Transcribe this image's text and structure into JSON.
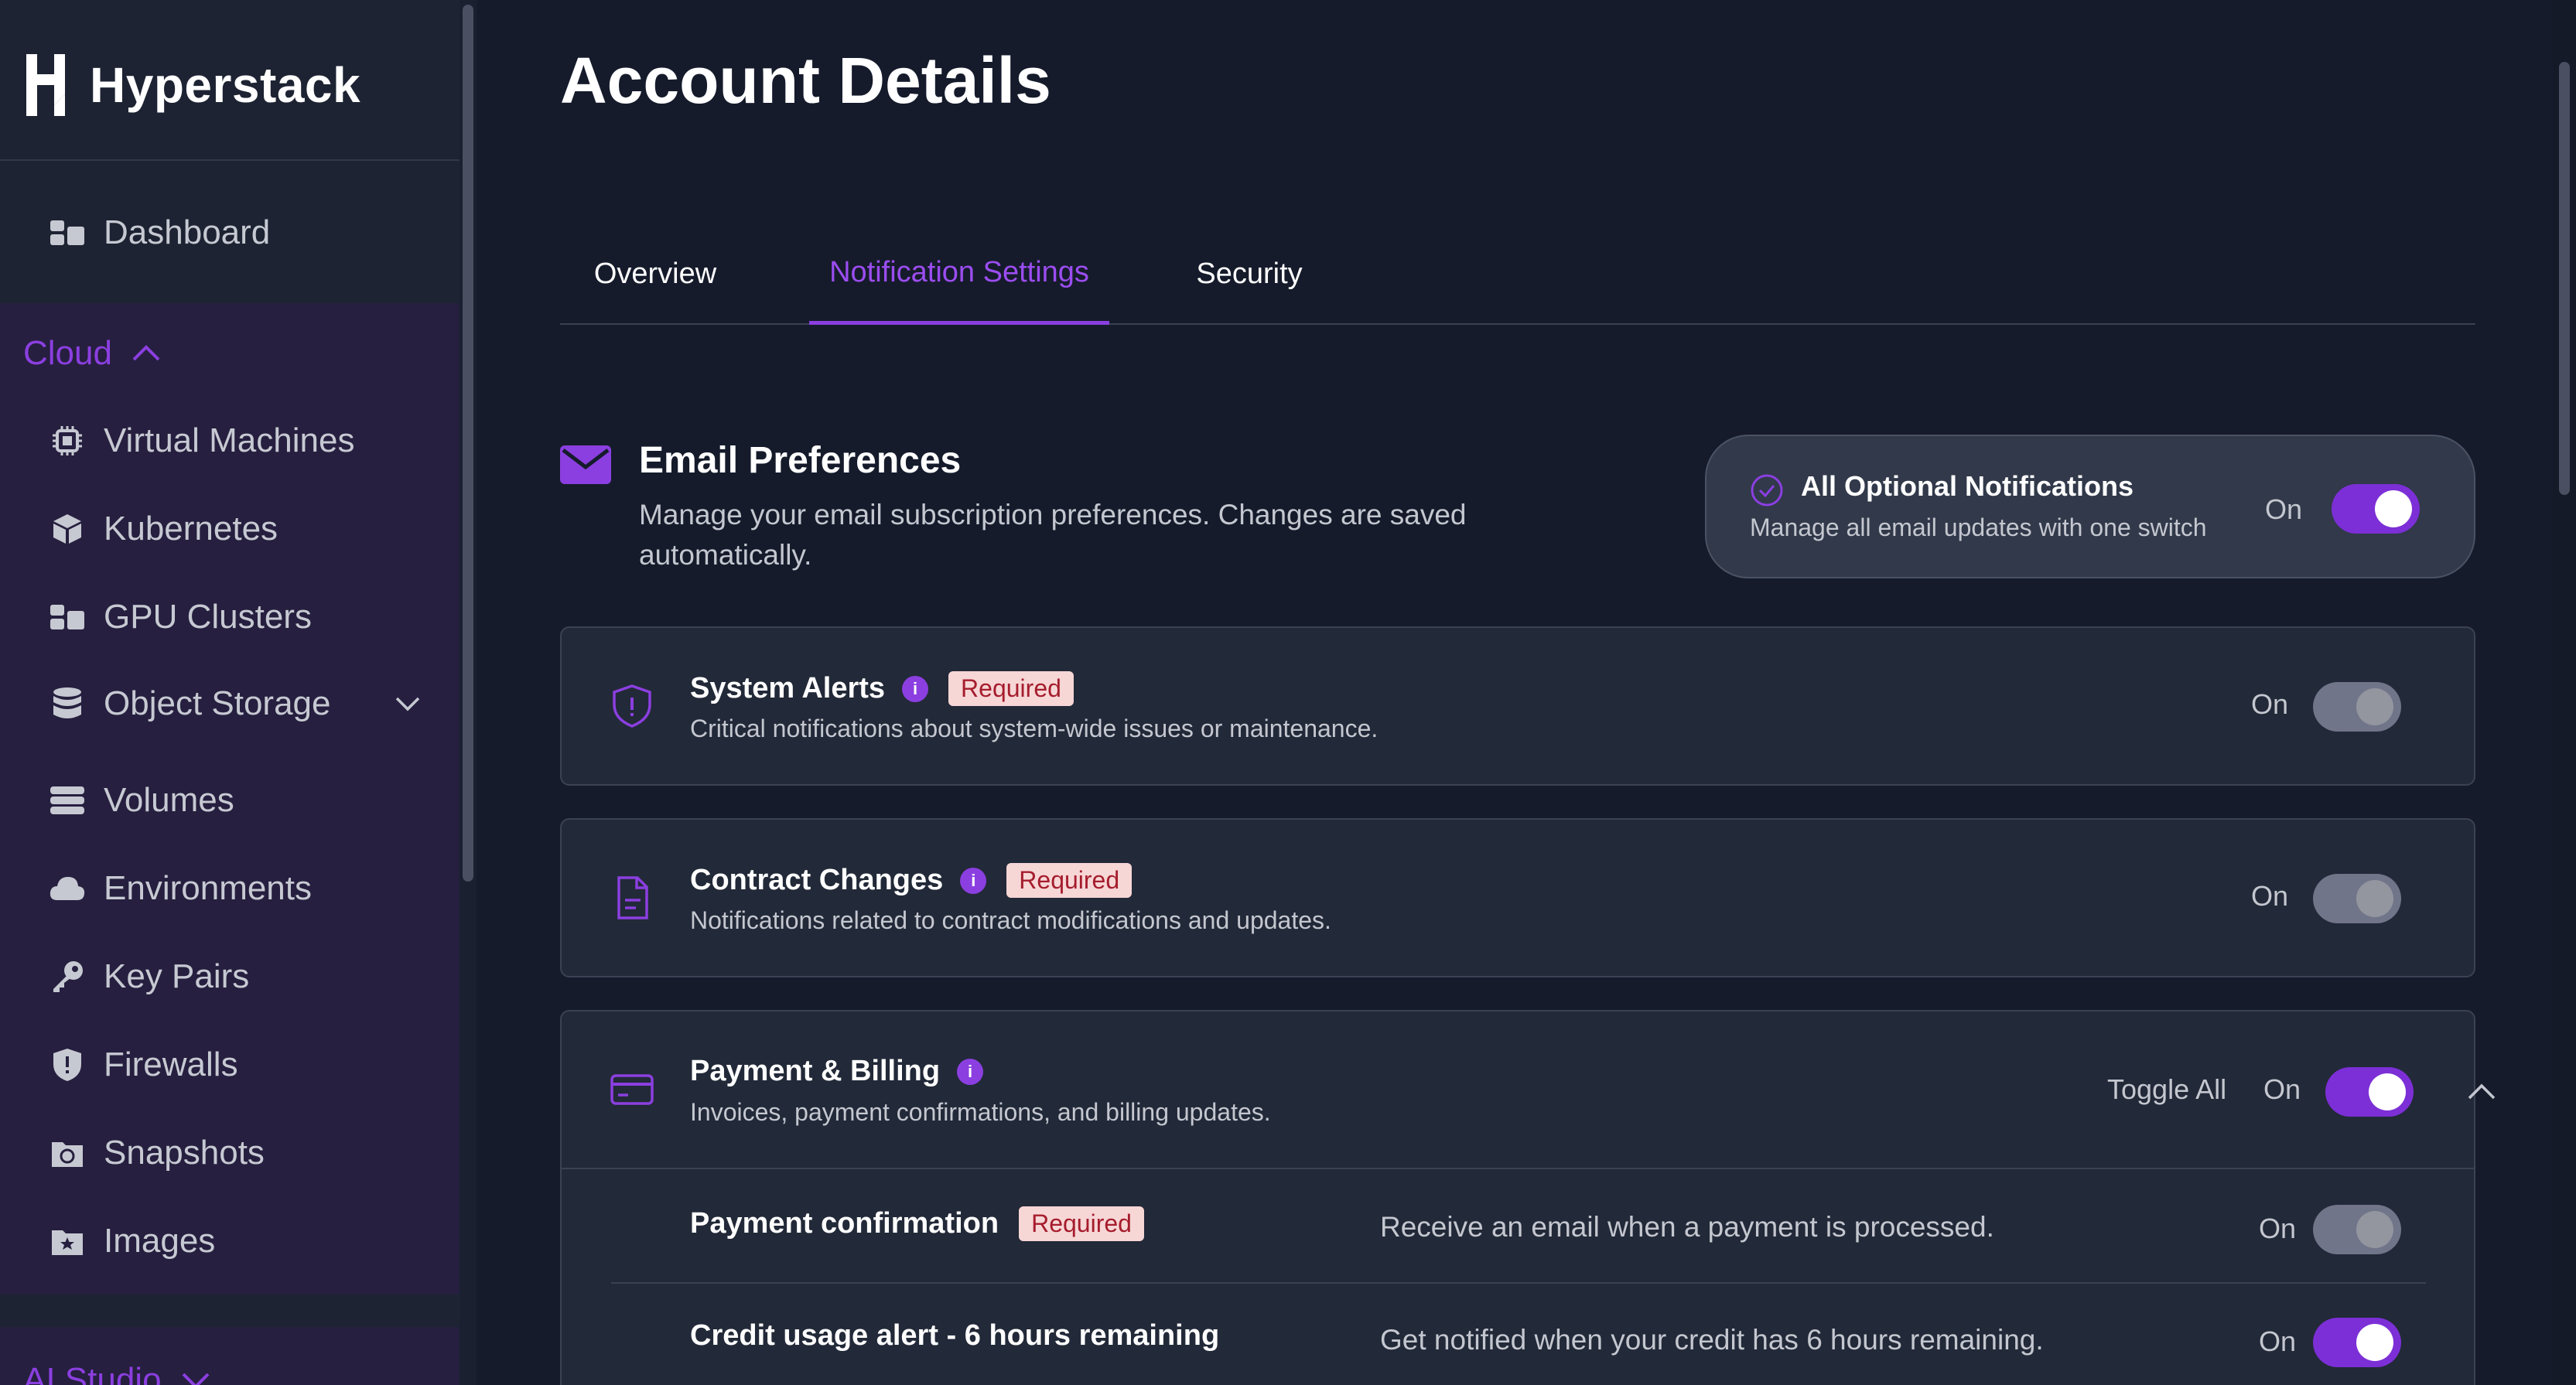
{
  "brand": {
    "name": "Hyperstack"
  },
  "sidebar": {
    "dashboard": "Dashboard",
    "cloud_section": "Cloud",
    "cloud_items": [
      {
        "label": "Virtual Machines",
        "icon": "chip-icon"
      },
      {
        "label": "Kubernetes",
        "icon": "cube-icon"
      },
      {
        "label": "GPU Clusters",
        "icon": "grid-icon"
      },
      {
        "label": "Object Storage",
        "icon": "database-icon"
      },
      {
        "label": "Volumes",
        "icon": "volumes-icon"
      },
      {
        "label": "Environments",
        "icon": "cloud-icon"
      },
      {
        "label": "Key Pairs",
        "icon": "key-icon"
      },
      {
        "label": "Firewalls",
        "icon": "shield-icon"
      },
      {
        "label": "Snapshots",
        "icon": "snapshot-icon"
      },
      {
        "label": "Images",
        "icon": "image-icon"
      }
    ],
    "ai_section": "AI Studio"
  },
  "page": {
    "title": "Account Details",
    "tabs": [
      "Overview",
      "Notification Settings",
      "Security"
    ],
    "active_tab": "Notification Settings"
  },
  "email_prefs": {
    "title": "Email Preferences",
    "description": "Manage your email subscription preferences. Changes are saved automatically."
  },
  "all_optional": {
    "title": "All Optional Notifications",
    "subtitle": "Manage all email updates with one switch",
    "state_label": "On",
    "enabled": true
  },
  "cards": {
    "system_alerts": {
      "title": "System Alerts",
      "badge": "Required",
      "description": "Critical notifications about system-wide issues or maintenance.",
      "state_label": "On"
    },
    "contract_changes": {
      "title": "Contract Changes",
      "badge": "Required",
      "description": "Notifications related to contract modifications and updates.",
      "state_label": "On"
    },
    "payment_billing": {
      "title": "Payment & Billing",
      "description": "Invoices, payment confirmations, and billing updates.",
      "toggle_all_label": "Toggle All",
      "state_label": "On",
      "items": [
        {
          "title": "Payment confirmation",
          "badge": "Required",
          "description": "Receive an email when a payment is processed.",
          "state_label": "On"
        },
        {
          "title": "Credit usage alert - 6 hours remaining",
          "description": "Get notified when your credit has 6 hours remaining.",
          "state_label": "On"
        }
      ]
    }
  },
  "colors": {
    "accent": "#8b3fe0",
    "background": "#151b2b",
    "sidebar": "#1d2332",
    "sidebar_section": "#261f3f",
    "card": "#222938",
    "badge_bg": "#f7d6d6",
    "badge_text": "#a51d2d"
  }
}
